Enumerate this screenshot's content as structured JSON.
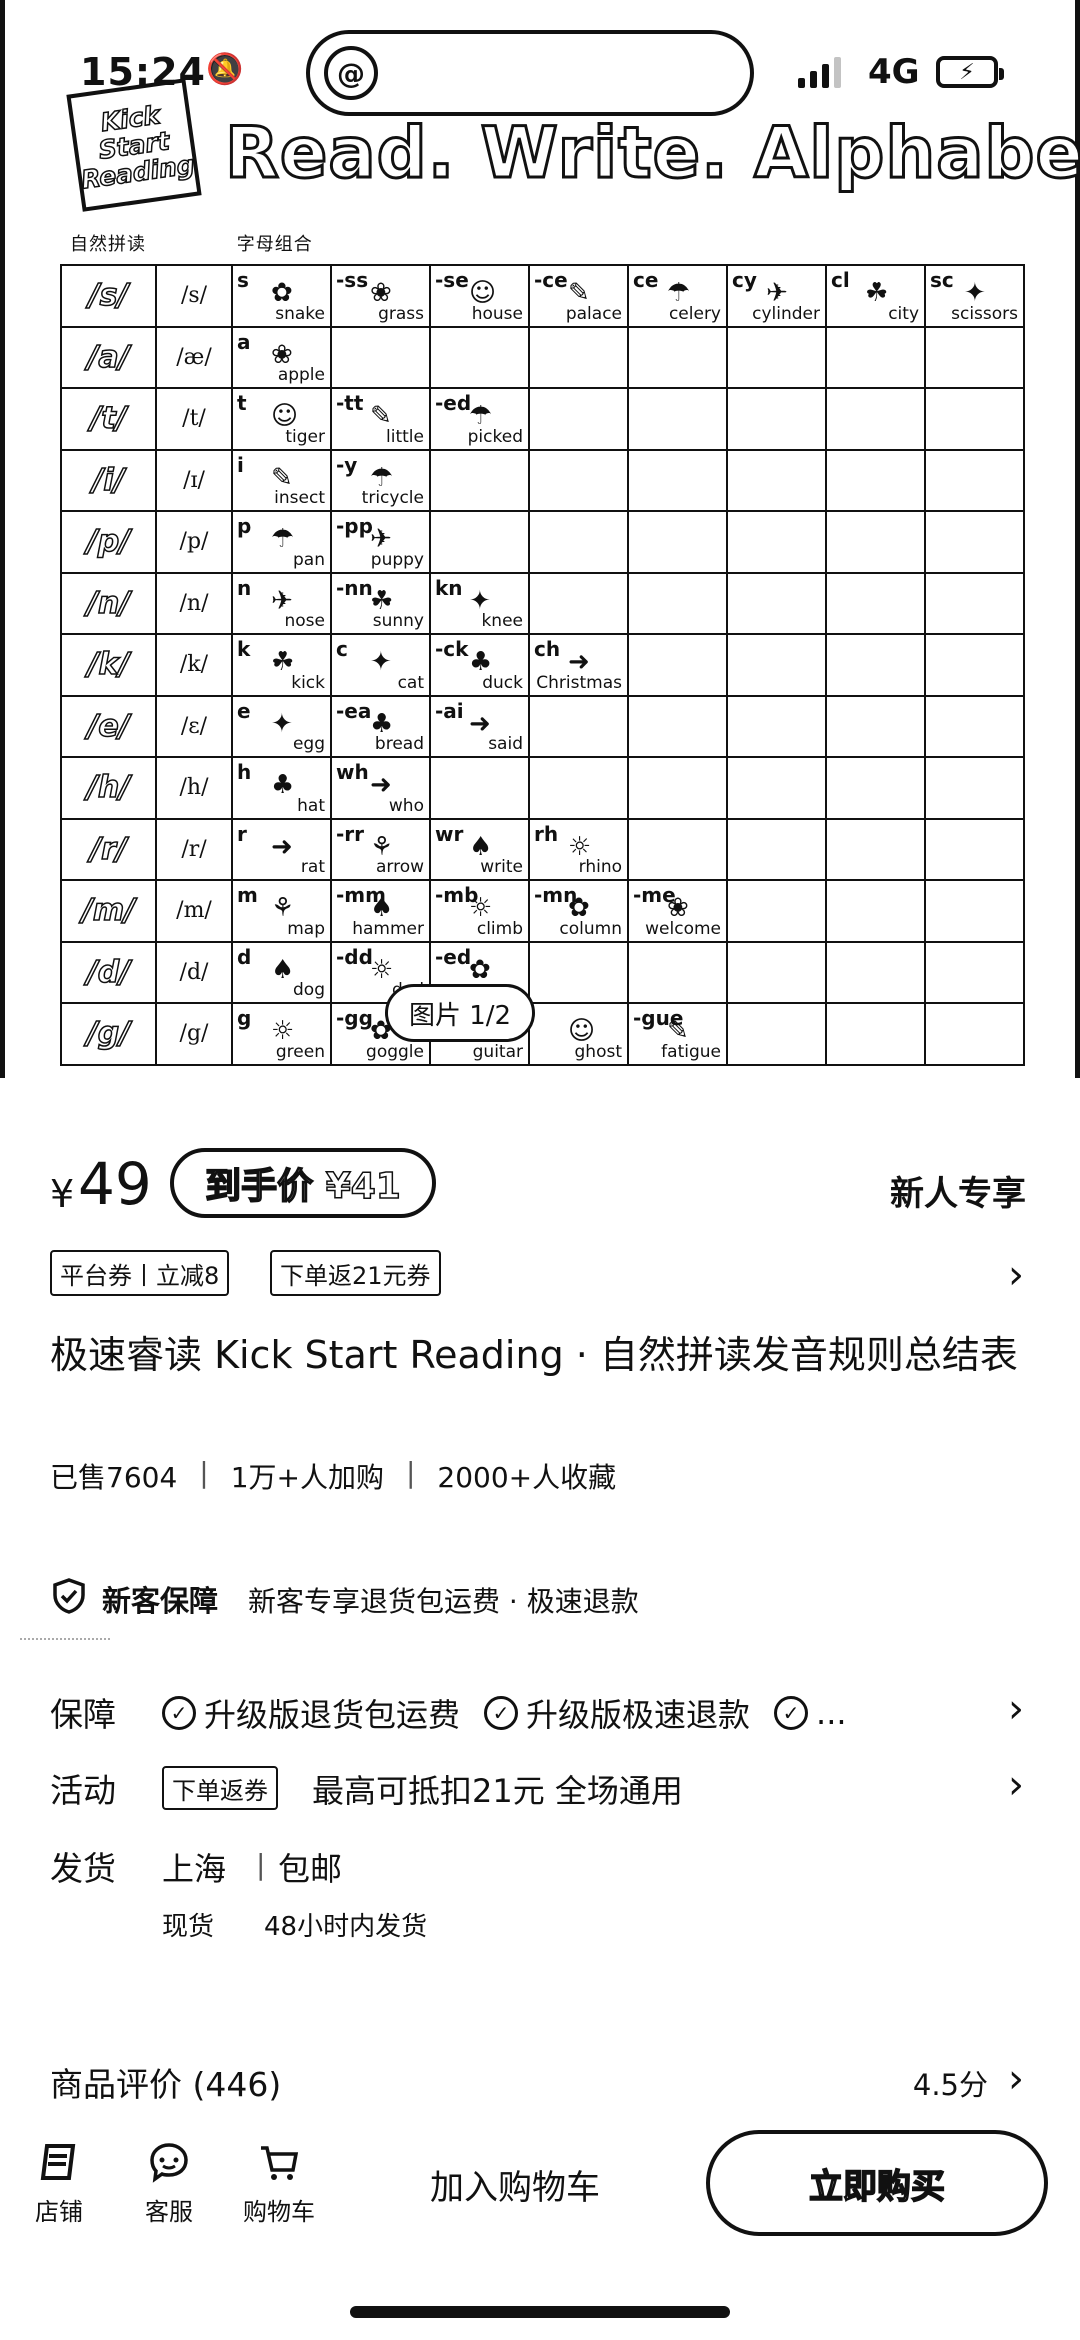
{
  "status_bar": {
    "time": "15:24",
    "network": "4G"
  },
  "hero": {
    "logo_lines": [
      "Kick",
      "Start",
      "Reading"
    ],
    "title": "Read. Write. Alphabet.",
    "subtitle": [
      "自然拼读",
      "字母组合"
    ],
    "image_counter": "图片 1/2",
    "table": [
      {
        "head": "/s/",
        "ipa": "/s/",
        "cells": [
          {
            "l": "s",
            "w": "snake"
          },
          {
            "l": "-ss",
            "w": "grass"
          },
          {
            "l": "-se",
            "w": "house"
          },
          {
            "l": "-ce",
            "w": "palace"
          },
          {
            "l": "ce",
            "w": "celery"
          },
          {
            "l": "cy",
            "w": "cylinder"
          },
          {
            "l": "cl",
            "w": "city"
          },
          {
            "l": "sc",
            "w": "scissors"
          }
        ]
      },
      {
        "head": "/a/",
        "ipa": "/æ/",
        "cells": [
          {
            "l": "a",
            "w": "apple"
          }
        ]
      },
      {
        "head": "/t/",
        "ipa": "/t/",
        "cells": [
          {
            "l": "t",
            "w": "tiger"
          },
          {
            "l": "-tt",
            "w": "little"
          },
          {
            "l": "-ed",
            "w": "picked"
          }
        ]
      },
      {
        "head": "/i/",
        "ipa": "/ɪ/",
        "cells": [
          {
            "l": "i",
            "w": "insect"
          },
          {
            "l": "-y",
            "w": "tricycle"
          }
        ]
      },
      {
        "head": "/p/",
        "ipa": "/p/",
        "cells": [
          {
            "l": "p",
            "w": "pan"
          },
          {
            "l": "-pp",
            "w": "puppy"
          }
        ]
      },
      {
        "head": "/n/",
        "ipa": "/n/",
        "cells": [
          {
            "l": "n",
            "w": "nose"
          },
          {
            "l": "-nn",
            "w": "sunny"
          },
          {
            "l": "kn",
            "w": "knee"
          }
        ]
      },
      {
        "head": "/k/",
        "ipa": "/k/",
        "cells": [
          {
            "l": "k",
            "w": "kick"
          },
          {
            "l": "c",
            "w": "cat"
          },
          {
            "l": "-ck",
            "w": "duck"
          },
          {
            "l": "ch",
            "w": "Christmas"
          }
        ]
      },
      {
        "head": "/e/",
        "ipa": "/ɛ/",
        "cells": [
          {
            "l": "e",
            "w": "egg"
          },
          {
            "l": "-ea",
            "w": "bread"
          },
          {
            "l": "-ai",
            "w": "said"
          }
        ]
      },
      {
        "head": "/h/",
        "ipa": "/h/",
        "cells": [
          {
            "l": "h",
            "w": "hat"
          },
          {
            "l": "wh",
            "w": "who"
          }
        ]
      },
      {
        "head": "/r/",
        "ipa": "/r/",
        "cells": [
          {
            "l": "r",
            "w": "rat"
          },
          {
            "l": "-rr",
            "w": "arrow"
          },
          {
            "l": "wr",
            "w": "write"
          },
          {
            "l": "rh",
            "w": "rhino"
          }
        ]
      },
      {
        "head": "/m/",
        "ipa": "/m/",
        "cells": [
          {
            "l": "m",
            "w": "map"
          },
          {
            "l": "-mm",
            "w": "hammer"
          },
          {
            "l": "-mb",
            "w": "climb"
          },
          {
            "l": "-mn",
            "w": "column"
          },
          {
            "l": "-me",
            "w": "welcome"
          }
        ]
      },
      {
        "head": "/d/",
        "ipa": "/d/",
        "cells": [
          {
            "l": "d",
            "w": "dog"
          },
          {
            "l": "-dd",
            "w": "dad"
          },
          {
            "l": "-ed",
            "w": ""
          }
        ]
      },
      {
        "head": "/g/",
        "ipa": "/g/",
        "cells": [
          {
            "l": "g",
            "w": "green"
          },
          {
            "l": "-gg",
            "w": "goggle"
          },
          {
            "l": "",
            "w": "guitar"
          },
          {
            "l": "",
            "w": "ghost"
          },
          {
            "l": "-gue",
            "w": "fatigue"
          }
        ]
      }
    ]
  },
  "price": {
    "currency": "¥",
    "value": "49",
    "final_price": "到手价 ¥41",
    "newbie_label": "新人专享"
  },
  "coupons": [
    "平台券丨立减8",
    "下单返21元券"
  ],
  "product": {
    "title": "极速睿读 Kick Start Reading · 自然拼读发音规则总结表",
    "stats": [
      "已售7604",
      "1万+人加购",
      "2000+人收藏"
    ]
  },
  "guarantee": {
    "title": "新客保障",
    "desc": "新客专享退货包运费 · 极速退款"
  },
  "details": {
    "guarantee_label": "保障",
    "guarantee_items": [
      "升级版退货包运费",
      "升级版极速退款",
      "..."
    ],
    "activity_label": "活动",
    "activity_tag": "下单返券",
    "activity_text": "最高可抵扣21元 全场通用",
    "shipping_label": "发货",
    "shipping_city": "上海",
    "shipping_free": "包邮",
    "stock": "现货",
    "dispatch": "48小时内发货"
  },
  "reviews": {
    "label": "商品评价 (446)",
    "score": "4.5分"
  },
  "bottom_bar": {
    "store": "店铺",
    "service": "客服",
    "cart": "购物车",
    "add_to_cart": "加入购物车",
    "buy_now": "立即购买"
  }
}
